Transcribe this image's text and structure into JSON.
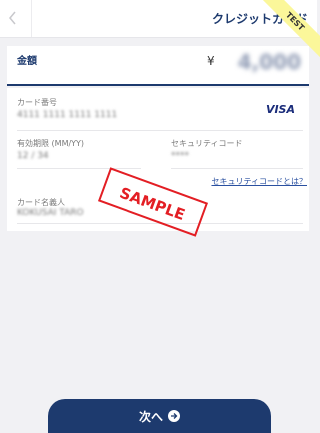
{
  "header": {
    "title": "クレジットカード",
    "ribbon": "TEST"
  },
  "amount": {
    "label": "金額",
    "currency": "¥",
    "value": "4,000"
  },
  "card": {
    "number_label": "カード番号",
    "number_value": "4111 1111 1111 1111",
    "brand": "VISA",
    "expiry_label": "有効期限 (MM/YY)",
    "expiry_value": "12 / 34",
    "security_label": "セキュリティコード",
    "security_value": "****",
    "security_help_link": "セキュリティコードとは？",
    "holder_label": "カード名義人",
    "holder_value": "KOKUSAI TARO"
  },
  "stamp": "SAMPLE",
  "next_button": "次へ"
}
